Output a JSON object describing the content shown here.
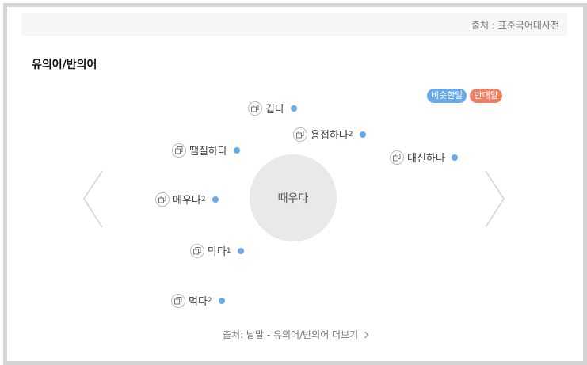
{
  "source": "출처 : 표준국어대사전",
  "title": "유의어/반의어",
  "legend": {
    "synonym": "비슷한말",
    "antonym": "반대말"
  },
  "center_word": "때우다",
  "words": [
    {
      "text": "깁다",
      "sup": ""
    },
    {
      "text": "용접하다",
      "sup": "2"
    },
    {
      "text": "땜질하다",
      "sup": ""
    },
    {
      "text": "대신하다",
      "sup": ""
    },
    {
      "text": "메우다",
      "sup": "2"
    },
    {
      "text": "막다",
      "sup": "1"
    },
    {
      "text": "먹다",
      "sup": "2"
    }
  ],
  "footer": "출처: 낱말 - 유의어/반의어 더보기",
  "colors": {
    "synonym": "#6aa9e9",
    "antonym": "#ec8064"
  },
  "icons": {
    "copy": "copy-icon",
    "prev": "chevron-left-icon",
    "next": "chevron-right-icon"
  }
}
